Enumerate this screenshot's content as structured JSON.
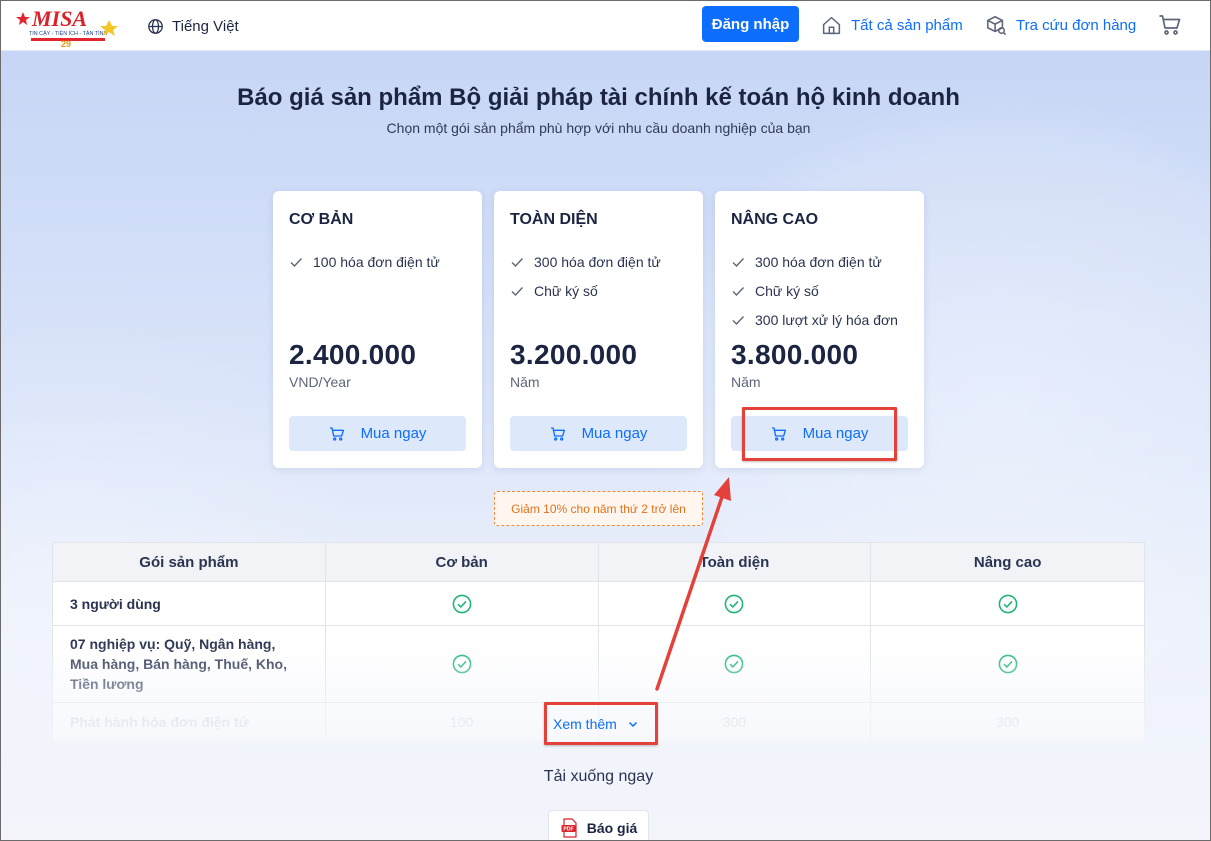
{
  "header": {
    "logo": {
      "brand": "MISA",
      "tagline": "TIN CẬY - TIỆN ÍCH - TẬN TÌNH",
      "badge": "29"
    },
    "language": "Tiếng Việt",
    "login_label": "Đăng nhập",
    "nav": [
      {
        "label": "Tất cả sản phẩm",
        "icon": "home-icon"
      },
      {
        "label": "Tra cứu đơn hàng",
        "icon": "package-search-icon"
      }
    ],
    "cart_icon": "cart-icon"
  },
  "hero": {
    "title": "Báo giá sản phẩm Bộ giải pháp tài chính kế toán hộ kinh doanh",
    "subtitle": "Chọn một gói sản phẩm phù hợp với nhu cầu doanh nghiệp của bạn"
  },
  "plans": [
    {
      "name": "CƠ BẢN",
      "features": [
        "100 hóa đơn điện tử"
      ],
      "price": "2.400.000",
      "unit": "VND/Year",
      "buy_label": "Mua ngay"
    },
    {
      "name": "TOÀN DIỆN",
      "features": [
        "300 hóa đơn điện tử",
        "Chữ ký số"
      ],
      "price": "3.200.000",
      "unit": "Năm",
      "buy_label": "Mua ngay"
    },
    {
      "name": "NÂNG CAO",
      "features": [
        "300 hóa đơn điện tử",
        "Chữ ký số",
        "300 lượt xử lý hóa đơn"
      ],
      "price": "3.800.000",
      "unit": "Năm",
      "buy_label": "Mua ngay"
    }
  ],
  "discount": "Giảm 10% cho năm thứ 2 trở lên",
  "comparison": {
    "headers": [
      "Gói sản phẩm",
      "Cơ bản",
      "Toàn diện",
      "Nâng cao"
    ],
    "rows": [
      {
        "label": "3 người dùng",
        "values": [
          "check",
          "check",
          "check"
        ]
      },
      {
        "label": "07 nghiệp vụ: Quỹ, Ngân hàng, Mua hàng, Bán hàng, Thuế, Kho, Tiền lương",
        "values": [
          "check",
          "check",
          "check"
        ]
      },
      {
        "label": "Phát hành hóa đơn điện tử",
        "values": [
          "100",
          "300",
          "300"
        ]
      }
    ],
    "see_more": "Xem thêm"
  },
  "download": {
    "title": "Tải xuống ngay",
    "quote_label": "Báo giá",
    "pdf_badge": "PDF"
  },
  "colors": {
    "primary": "#0d6efd",
    "check_green": "#22b573",
    "annotation_red": "#e3413a",
    "discount_orange": "#e2711d"
  }
}
